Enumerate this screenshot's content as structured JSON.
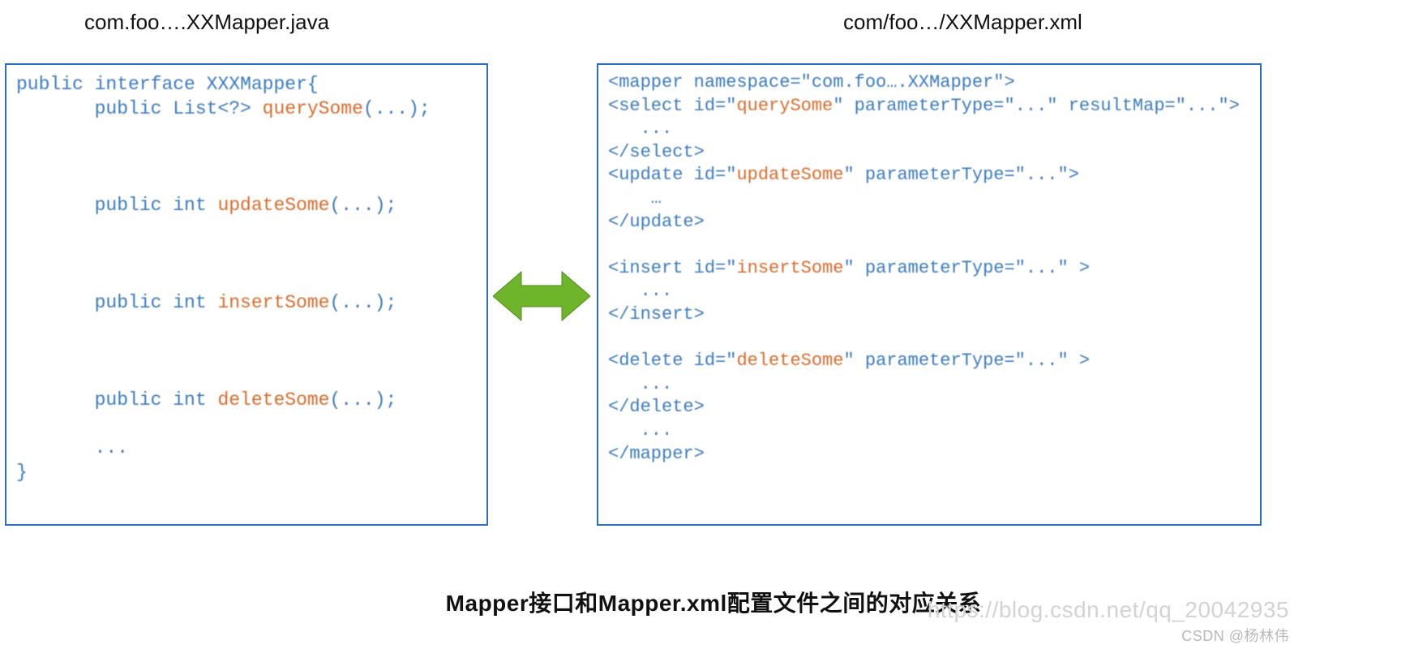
{
  "titles": {
    "left": "com.foo….XXMapper.java",
    "right": "com/foo…/XXMapper.xml"
  },
  "java": {
    "l1a": "public ",
    "l1b": "interface ",
    "l1c": "XXXMapper{",
    "l2a": "       public ",
    "l2b": "List<?> ",
    "l2c": "querySome",
    "l2d": "(...);",
    "l3a": "       public ",
    "l3b": "int ",
    "l3c": "updateSome",
    "l3d": "(...);",
    "l4a": "       public ",
    "l4b": "int ",
    "l4c": "insertSome",
    "l4d": "(...);",
    "l5a": "       public ",
    "l5b": "int ",
    "l5c": "deleteSome",
    "l5d": "(...);",
    "l6": "       ...",
    "l7": "}"
  },
  "xml": {
    "m1": "<mapper namespace=\"com.foo….XXMapper\">",
    "s1a": "<select id=\"",
    "s1b": "querySome",
    "s1c": "\" parameterType=\"...\" resultMap=\"...\">",
    "dots": "   ...",
    "s1e": "</select>",
    "u1a": "<update id=\"",
    "u1b": "updateSome",
    "u1c": "\" parameterType=\"...\">",
    "dots2": "    …",
    "u1e": "</update>",
    "i1a": "<insert id=\"",
    "i1b": "insertSome",
    "i1c": "\" parameterType=\"...\" >",
    "i1e": "</insert>",
    "d1a": "<delete id=\"",
    "d1b": "deleteSome",
    "d1c": "\" parameterType=\"...\" >",
    "d1e": "</delete>",
    "dots3": "   ...",
    "m2": "</mapper>"
  },
  "caption": "Mapper接口和Mapper.xml配置文件之间的对应关系",
  "watermark_link": "https://blog.csdn.net/qq_20042935",
  "watermark_author": "CSDN @杨林伟",
  "colors": {
    "border": "#2a6fbf",
    "keyword": "#3a7ac0",
    "function": "#d96b2b",
    "arrow": "#6fb52b"
  }
}
